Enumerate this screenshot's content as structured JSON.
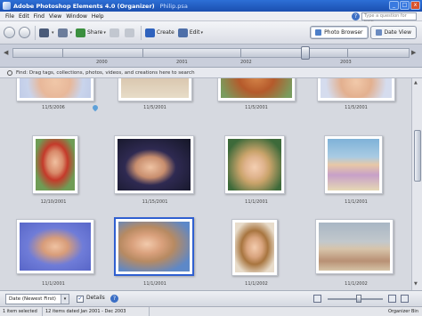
{
  "window": {
    "title": "Adobe Photoshop Elements 4.0 (Organizer)",
    "filename": "Philip.psa",
    "controls": [
      "_",
      "□",
      "x"
    ]
  },
  "menu": {
    "items": [
      "File",
      "Edit",
      "Find",
      "View",
      "Window",
      "Help"
    ],
    "help_placeholder": "Type a question for help",
    "help_q": "?"
  },
  "toolbar": {
    "share_label": "Share",
    "create_label": "Create",
    "edit_label": "Edit",
    "caret": "▾",
    "tabs": [
      {
        "label": "Photo Browser",
        "active": true
      },
      {
        "label": "Date View",
        "active": false
      }
    ]
  },
  "timeline": {
    "years": [
      "2000",
      "2001",
      "2002",
      "2003"
    ],
    "left_arrow": "◀",
    "right_arrow": "▶"
  },
  "find": {
    "hint": "Find: Drag tags, collections, photos, videos, and creations here to search"
  },
  "photos": {
    "row1": [
      "11/5/2006",
      "11/5/2001",
      "11/5/2001",
      "11/5/2001"
    ],
    "row2": [
      "12/10/2001",
      "11/15/2001",
      "11/1/2001",
      "11/1/2001"
    ],
    "row3": [
      "11/1/2001",
      "11/1/2001",
      "11/1/2002",
      "11/1/2002"
    ]
  },
  "bottombar": {
    "sort_label": "Date (Newest First)",
    "sort_dd": "▾",
    "details_label": "Details",
    "details_check": "✓",
    "help": "?"
  },
  "statusbar": {
    "selected": "1 item selected",
    "shown": "12 items dated Jan 2001 - Dec 2003",
    "bin": "Organizer Bin"
  },
  "scrollbar": {
    "up": "▲",
    "down": "▼"
  },
  "colors": {
    "titlebar": "#1b4fb0",
    "accent": "#2f5fd0"
  }
}
